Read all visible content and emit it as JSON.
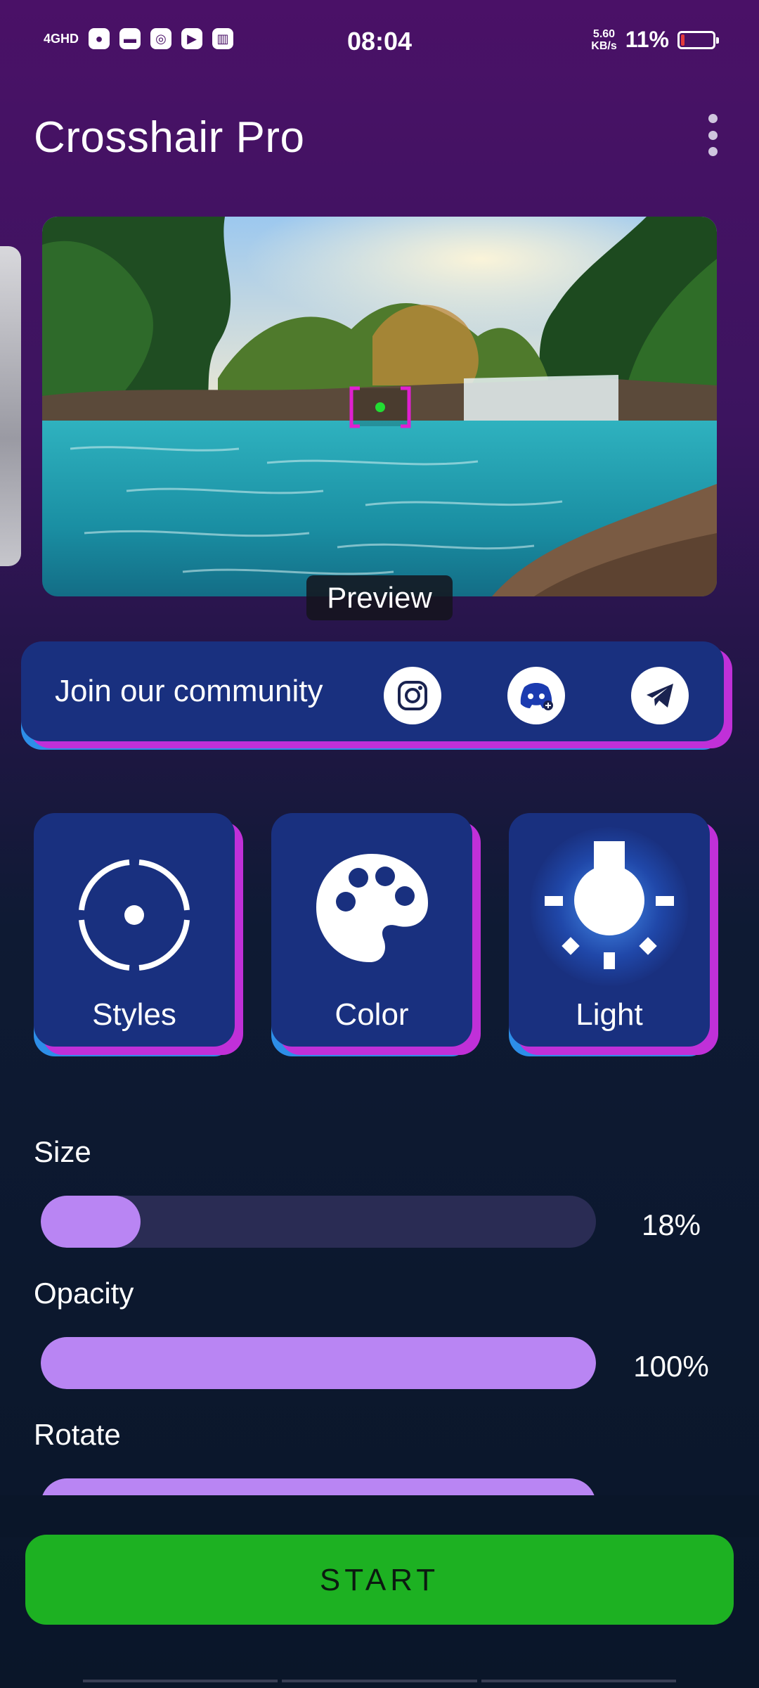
{
  "status_bar": {
    "network": "4GHD",
    "time": "08:04",
    "speed_value": "5.60",
    "speed_unit": "KB/s",
    "battery_percent": "11%",
    "battery_level": 0.11,
    "icons": [
      "signal-icon",
      "wechat-icon",
      "mail-icon",
      "app-icon",
      "play-icon",
      "book-icon"
    ]
  },
  "header": {
    "title": "Crosshair Pro",
    "menu_icon": "more-vertical-icon"
  },
  "preview": {
    "label": "Preview",
    "crosshair_color": "#e020d0",
    "dot_color": "#22dd33"
  },
  "community": {
    "text": "Join our community",
    "icons": [
      "instagram-icon",
      "discord-icon",
      "telegram-icon"
    ]
  },
  "tiles": [
    {
      "label": "Styles",
      "icon": "crosshair-icon"
    },
    {
      "label": "Color",
      "icon": "palette-icon"
    },
    {
      "label": "Light",
      "icon": "light-bulb-icon"
    }
  ],
  "sliders": [
    {
      "label": "Size",
      "value_text": "18%",
      "level": 0.18
    },
    {
      "label": "Opacity",
      "value_text": "100%",
      "level": 1.0
    },
    {
      "label": "Rotate",
      "value_text": "",
      "level": 1.0
    }
  ],
  "start_button": {
    "label": "START",
    "color": "#1db122"
  },
  "colors": {
    "accent_purple": "#b985f3",
    "tile_blue": "#19307f",
    "shadow_magenta": "#c030d8",
    "shadow_blue": "#2d8ee8"
  }
}
